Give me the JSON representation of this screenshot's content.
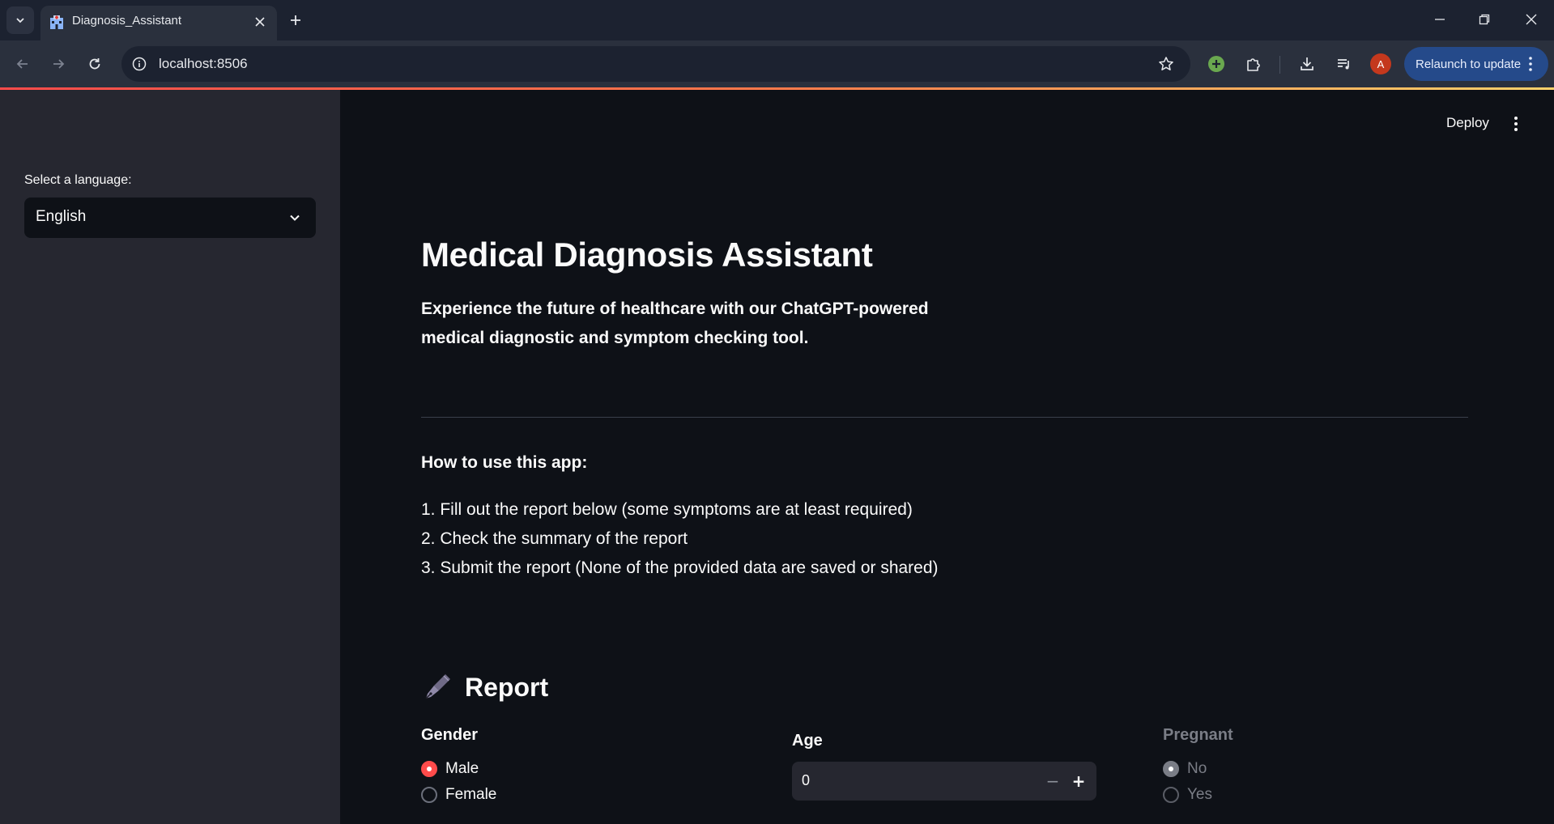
{
  "browser": {
    "tab_title": "Diagnosis_Assistant",
    "url": "localhost:8506",
    "relaunch_label": "Relaunch to update",
    "avatar_letter": "A"
  },
  "sidebar": {
    "language_label": "Select a language:",
    "language_value": "English"
  },
  "header": {
    "deploy_label": "Deploy"
  },
  "main": {
    "title": "Medical Diagnosis Assistant",
    "subtitle": "Experience the future of healthcare with our ChatGPT-powered medical diagnostic and symptom checking tool.",
    "howto_heading": "How to use this app:",
    "steps": [
      "1. Fill out the report below (some symptoms are at least required)",
      "2. Check the summary of the report",
      "3. Submit the report (None of the provided data are saved or shared)"
    ]
  },
  "report": {
    "heading": "Report",
    "gender": {
      "label": "Gender",
      "options": [
        "Male",
        "Female"
      ],
      "selected": "Male"
    },
    "age": {
      "label": "Age",
      "value": "0",
      "decrement": "−",
      "increment": "+"
    },
    "pregnant": {
      "label": "Pregnant",
      "options": [
        "No",
        "Yes"
      ],
      "selected": "No",
      "disabled": true
    }
  },
  "colors": {
    "accent": "#ff4b4b",
    "background": "#0e1117",
    "sidebar": "#262730",
    "relaunch": "#254a8a"
  }
}
